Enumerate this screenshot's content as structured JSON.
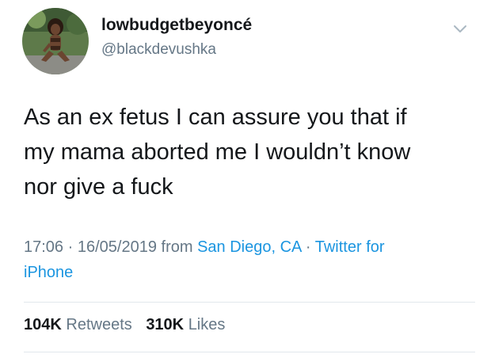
{
  "user": {
    "display_name": "lowbudgetbeyoncé",
    "handle": "@blackdevushka"
  },
  "tweet": {
    "text_lines": [
      "As an ex fetus I can assure you that if",
      "my mama aborted me I wouldn’t know",
      "nor give a fuck"
    ],
    "time": "17:06",
    "date": "16/05/2019",
    "from_label": "from",
    "location": "San Diego, CA",
    "source_line1": "Twitter for",
    "source_line2": "iPhone",
    "separator": "·"
  },
  "stats": {
    "retweets_count": "104K",
    "retweets_label": "Retweets",
    "likes_count": "310K",
    "likes_label": "Likes"
  },
  "colors": {
    "text": "#14171a",
    "secondary": "#657786",
    "link": "#1b95e0",
    "divider": "#e1e8ed"
  },
  "icons": {
    "menu": "chevron-down-icon"
  }
}
